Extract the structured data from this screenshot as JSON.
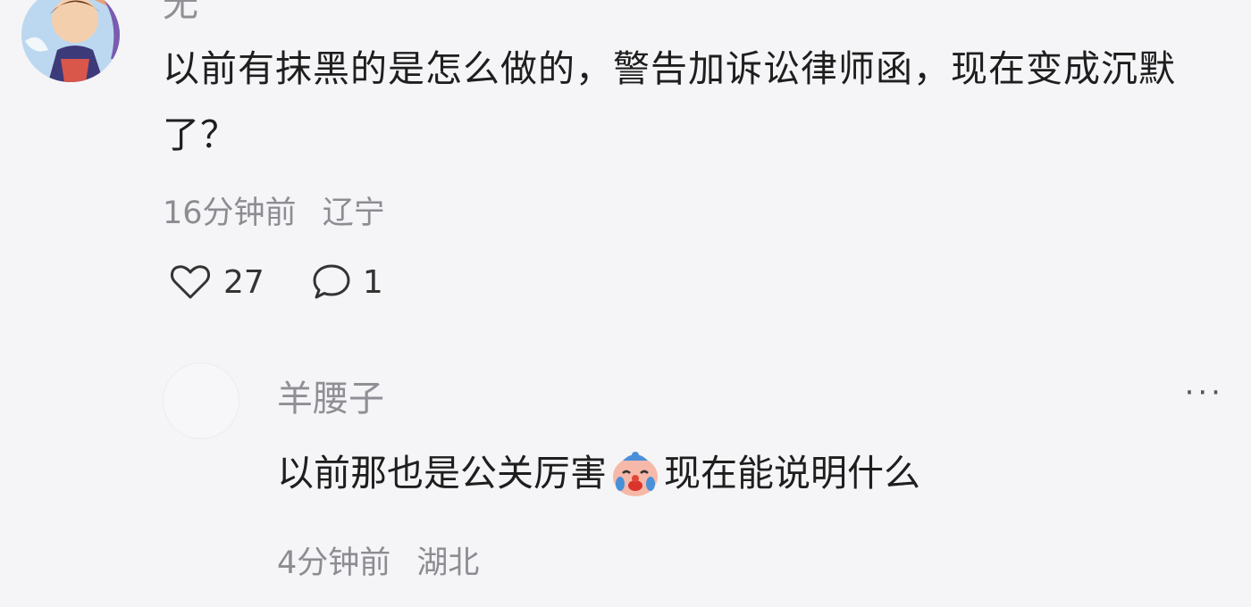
{
  "top_comment": {
    "username": "无",
    "text": "以前有抹黑的是怎么做的，警告加诉讼律师函，现在变成沉默了？",
    "time": "16分钟前",
    "location": "辽宁",
    "likes": "27",
    "replies": "1"
  },
  "reply": {
    "username": "羊腰子",
    "text_before": "以前那也是公关厉害",
    "emoji": "crying-clown-emoji",
    "text_after": "现在能说明什么",
    "time": "4分钟前",
    "location": "湖北",
    "more_label": "···"
  },
  "icons": {
    "like": "heart-icon",
    "reply": "speech-bubble-icon"
  }
}
